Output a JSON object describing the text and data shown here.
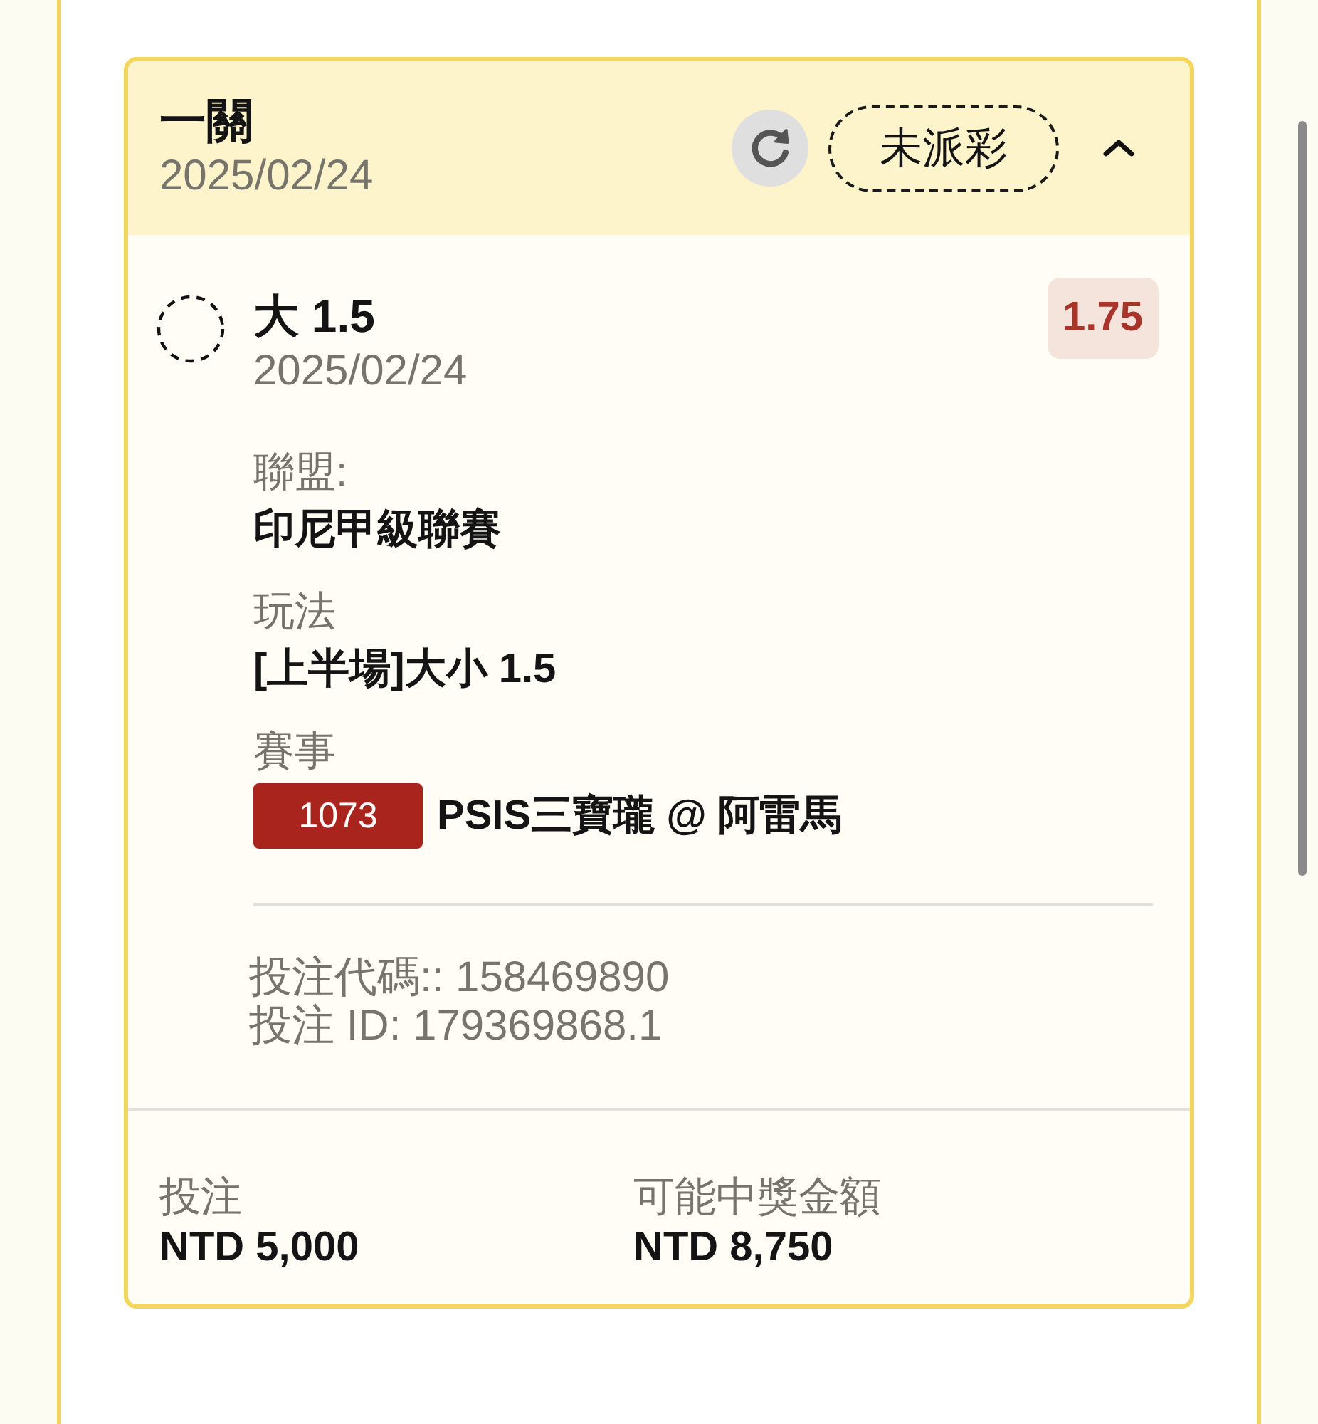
{
  "bet_card": {
    "header": {
      "title": "一關",
      "date": "2025/02/24",
      "status": "未派彩",
      "expanded": true
    },
    "selection": {
      "name": "大 1.5",
      "date": "2025/02/24",
      "odds": "1.75"
    },
    "details": [
      {
        "label": "聯盟:",
        "value": "印尼甲級聯賽"
      },
      {
        "label": "玩法",
        "value": "[上半場]大小 1.5"
      },
      {
        "label": "賽事",
        "match_code": "1073",
        "value": "PSIS三寶瓏 @ 阿雷馬"
      }
    ],
    "references": [
      "投注代碼:: 158469890",
      "投注 ID: 179369868.1"
    ],
    "totals": [
      {
        "label": "投注",
        "value": "NTD 5,000"
      },
      {
        "label": "可能中獎金額",
        "value": "NTD 8,750"
      }
    ]
  }
}
